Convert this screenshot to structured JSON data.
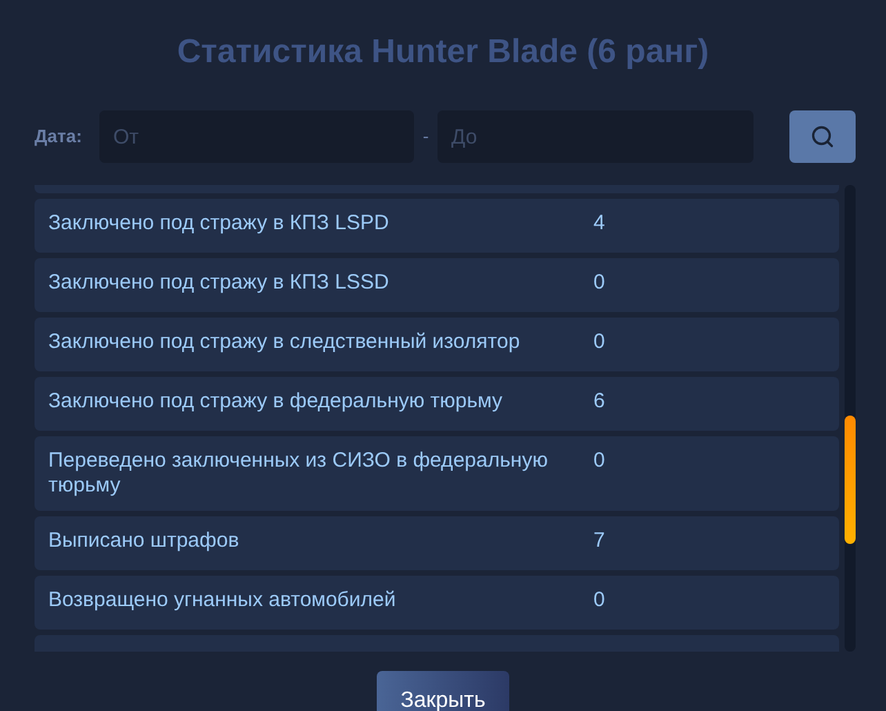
{
  "title": "Статистика Hunter Blade (6 ранг)",
  "filter": {
    "label": "Дата:",
    "from": {
      "placeholder": "От"
    },
    "separator": "-",
    "to": {
      "placeholder": "До"
    }
  },
  "rows": [
    {
      "label": "Заключено под стражу в КПЗ LSPD",
      "value": "4"
    },
    {
      "label": "Заключено под стражу в КПЗ LSSD",
      "value": "0"
    },
    {
      "label": "Заключено под стражу в следственный изолятор",
      "value": "0"
    },
    {
      "label": "Заключено под стражу в федеральную тюрьму",
      "value": "6"
    },
    {
      "label": "Переведено заключенных из СИЗО в федеральную тюрьму",
      "value": "0"
    },
    {
      "label": "Выписано штрафов",
      "value": "7"
    },
    {
      "label": "Возвращено угнанных автомобилей",
      "value": "0"
    }
  ],
  "close_button": "Закрыть"
}
